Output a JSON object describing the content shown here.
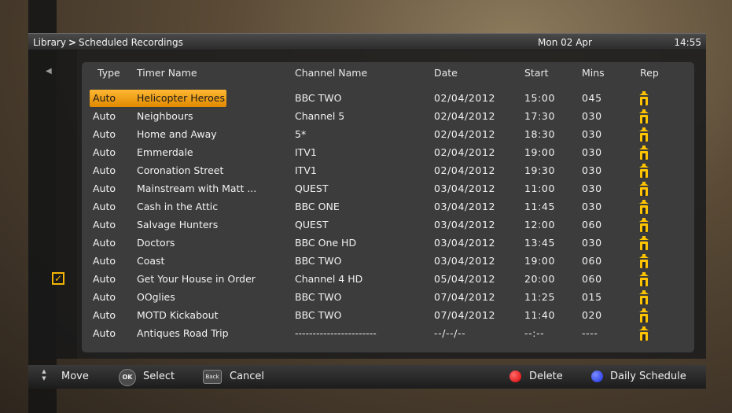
{
  "header": {
    "breadcrumb_root": "Library",
    "breadcrumb_sep": ">",
    "breadcrumb_current": "Scheduled Recordings",
    "date": "Mon 02 Apr",
    "time": "14:55"
  },
  "table": {
    "columns": {
      "type": "Type",
      "name": "Timer Name",
      "channel": "Channel Name",
      "date": "Date",
      "start": "Start",
      "mins": "Mins",
      "rep": "Rep"
    },
    "rows": [
      {
        "type": "Auto",
        "name": "Helicopter Heroes",
        "channel": "BBC TWO",
        "date": "02/04/2012",
        "start": "15:00",
        "mins": "045",
        "rep": "repeat-icon"
      },
      {
        "type": "Auto",
        "name": "Neighbours",
        "channel": "Channel 5",
        "date": "02/04/2012",
        "start": "17:30",
        "mins": "030",
        "rep": "repeat-icon"
      },
      {
        "type": "Auto",
        "name": "Home and Away",
        "channel": "5*",
        "date": "02/04/2012",
        "start": "18:30",
        "mins": "030",
        "rep": "repeat-icon"
      },
      {
        "type": "Auto",
        "name": "Emmerdale",
        "channel": "ITV1",
        "date": "02/04/2012",
        "start": "19:00",
        "mins": "030",
        "rep": "repeat-icon"
      },
      {
        "type": "Auto",
        "name": "Coronation Street",
        "channel": "ITV1",
        "date": "02/04/2012",
        "start": "19:30",
        "mins": "030",
        "rep": "repeat-icon"
      },
      {
        "type": "Auto",
        "name": "Mainstream with Matt ...",
        "channel": "QUEST",
        "date": "03/04/2012",
        "start": "11:00",
        "mins": "030",
        "rep": "repeat-icon"
      },
      {
        "type": "Auto",
        "name": "Cash in the Attic",
        "channel": "BBC ONE",
        "date": "03/04/2012",
        "start": "11:45",
        "mins": "030",
        "rep": "repeat-icon"
      },
      {
        "type": "Auto",
        "name": "Salvage Hunters",
        "channel": "QUEST",
        "date": "03/04/2012",
        "start": "12:00",
        "mins": "060",
        "rep": "repeat-icon"
      },
      {
        "type": "Auto",
        "name": "Doctors",
        "channel": "BBC One HD",
        "date": "03/04/2012",
        "start": "13:45",
        "mins": "030",
        "rep": "repeat-icon"
      },
      {
        "type": "Auto",
        "name": "Coast",
        "channel": "BBC TWO",
        "date": "03/04/2012",
        "start": "19:00",
        "mins": "060",
        "rep": "repeat-icon"
      },
      {
        "type": "Auto",
        "name": "Get Your House in Order",
        "channel": "Channel 4 HD",
        "date": "05/04/2012",
        "start": "20:00",
        "mins": "060",
        "rep": "repeat-icon"
      },
      {
        "type": "Auto",
        "name": "OOglies",
        "channel": "BBC TWO",
        "date": "07/04/2012",
        "start": "11:25",
        "mins": "015",
        "rep": "repeat-icon"
      },
      {
        "type": "Auto",
        "name": "MOTD Kickabout",
        "channel": "BBC TWO",
        "date": "07/04/2012",
        "start": "11:40",
        "mins": "020",
        "rep": "repeat-icon"
      },
      {
        "type": "Auto",
        "name": "Antiques Road Trip",
        "channel": "-----------------------",
        "date": "--/--/--",
        "start": "--:--",
        "mins": "----",
        "rep": "repeat-icon"
      }
    ],
    "selected_index": 0
  },
  "footer": {
    "move": "Move",
    "ok_key": "OK",
    "select": "Select",
    "back_key": "Back",
    "cancel": "Cancel",
    "delete": "Delete",
    "daily": "Daily Schedule"
  },
  "colors": {
    "highlight": "#f5a000",
    "red_key": "#e00000",
    "blue_key": "#2030e0",
    "rep_icon": "#ffc400"
  }
}
